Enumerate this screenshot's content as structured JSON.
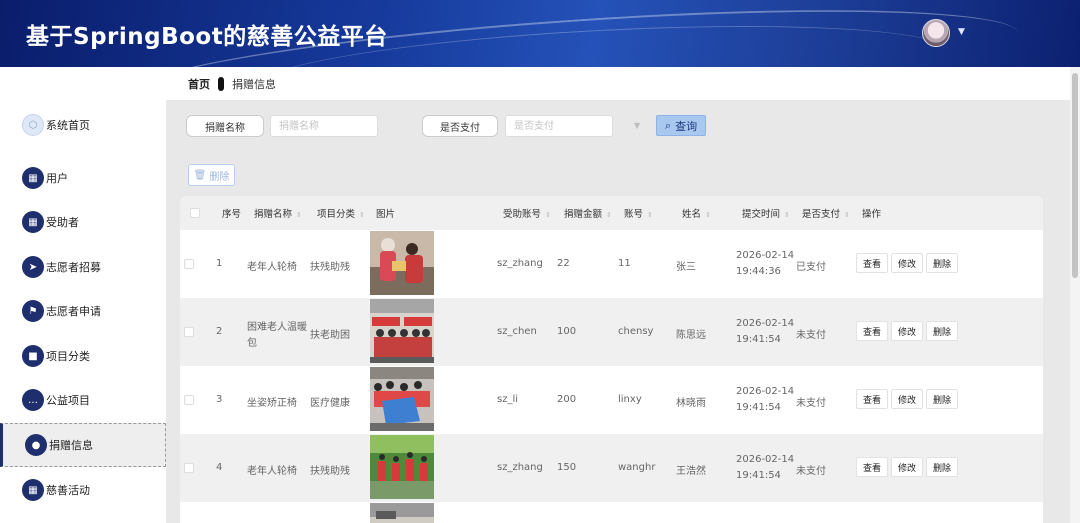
{
  "app": {
    "title": "基于SpringBoot的慈善公益平台"
  },
  "sidebar": {
    "items": [
      {
        "label": "系统首页",
        "icon": "home-icon"
      },
      {
        "label": "用户",
        "icon": "grid-icon"
      },
      {
        "label": "受助者",
        "icon": "grid-icon"
      },
      {
        "label": "志愿者招募",
        "icon": "send-icon"
      },
      {
        "label": "志愿者申请",
        "icon": "flag-icon"
      },
      {
        "label": "项目分类",
        "icon": "briefcase-icon"
      },
      {
        "label": "公益项目",
        "icon": "chat-icon"
      },
      {
        "label": "捐赠信息",
        "icon": "pin-icon"
      },
      {
        "label": "慈善活动",
        "icon": "grid-icon"
      }
    ],
    "active_index": 7
  },
  "breadcrumb": {
    "home": "首页",
    "current": "捐赠信息"
  },
  "search": {
    "name_label": "捐赠名称",
    "name_placeholder": "捐赠名称",
    "pay_label": "是否支付",
    "pay_placeholder": "是否支付",
    "query_label": "查询"
  },
  "toolbar": {
    "delete_label": "删除"
  },
  "table": {
    "headers": {
      "index": "序号",
      "name": "捐赠名称",
      "category": "项目分类",
      "image": "图片",
      "receiver": "受助账号",
      "amount": "捐赠金额",
      "account": "账号",
      "person": "姓名",
      "time": "提交时间",
      "paid": "是否支付",
      "ops": "操作"
    },
    "rows": [
      {
        "index": "1",
        "name": "老年人轮椅",
        "category": "扶残助残",
        "receiver": "sz_zhang",
        "amount": "22",
        "account": "11",
        "person": "张三",
        "date": "2026-02-14",
        "time": "19:44:36",
        "paid": "已支付",
        "img": "a"
      },
      {
        "index": "2",
        "name": "困难老人温暖",
        "name2": "包",
        "category": "扶老助困",
        "receiver": "sz_chen",
        "amount": "100",
        "account": "chensy",
        "person": "陈思远",
        "date": "2026-02-14",
        "time": "19:41:54",
        "paid": "未支付",
        "img": "b"
      },
      {
        "index": "3",
        "name": "坐姿矫正椅",
        "category": "医疗健康",
        "receiver": "sz_li",
        "amount": "200",
        "account": "linxy",
        "person": "林晓雨",
        "date": "2026-02-14",
        "time": "19:41:54",
        "paid": "未支付",
        "img": "c"
      },
      {
        "index": "4",
        "name": "老年人轮椅",
        "category": "扶残助残",
        "receiver": "sz_zhang",
        "amount": "150",
        "account": "wanghr",
        "person": "王浩然",
        "date": "2026-02-14",
        "time": "19:41:54",
        "paid": "未支付",
        "img": "d"
      }
    ],
    "actions": {
      "view": "查看",
      "edit": "修改",
      "delete": "删除"
    }
  },
  "colors": {
    "header_dark": "#0a1d6b",
    "header_mid": "#2552b8",
    "nav_icon": "#1f2f6e",
    "query_bg": "#a8c8f0"
  }
}
